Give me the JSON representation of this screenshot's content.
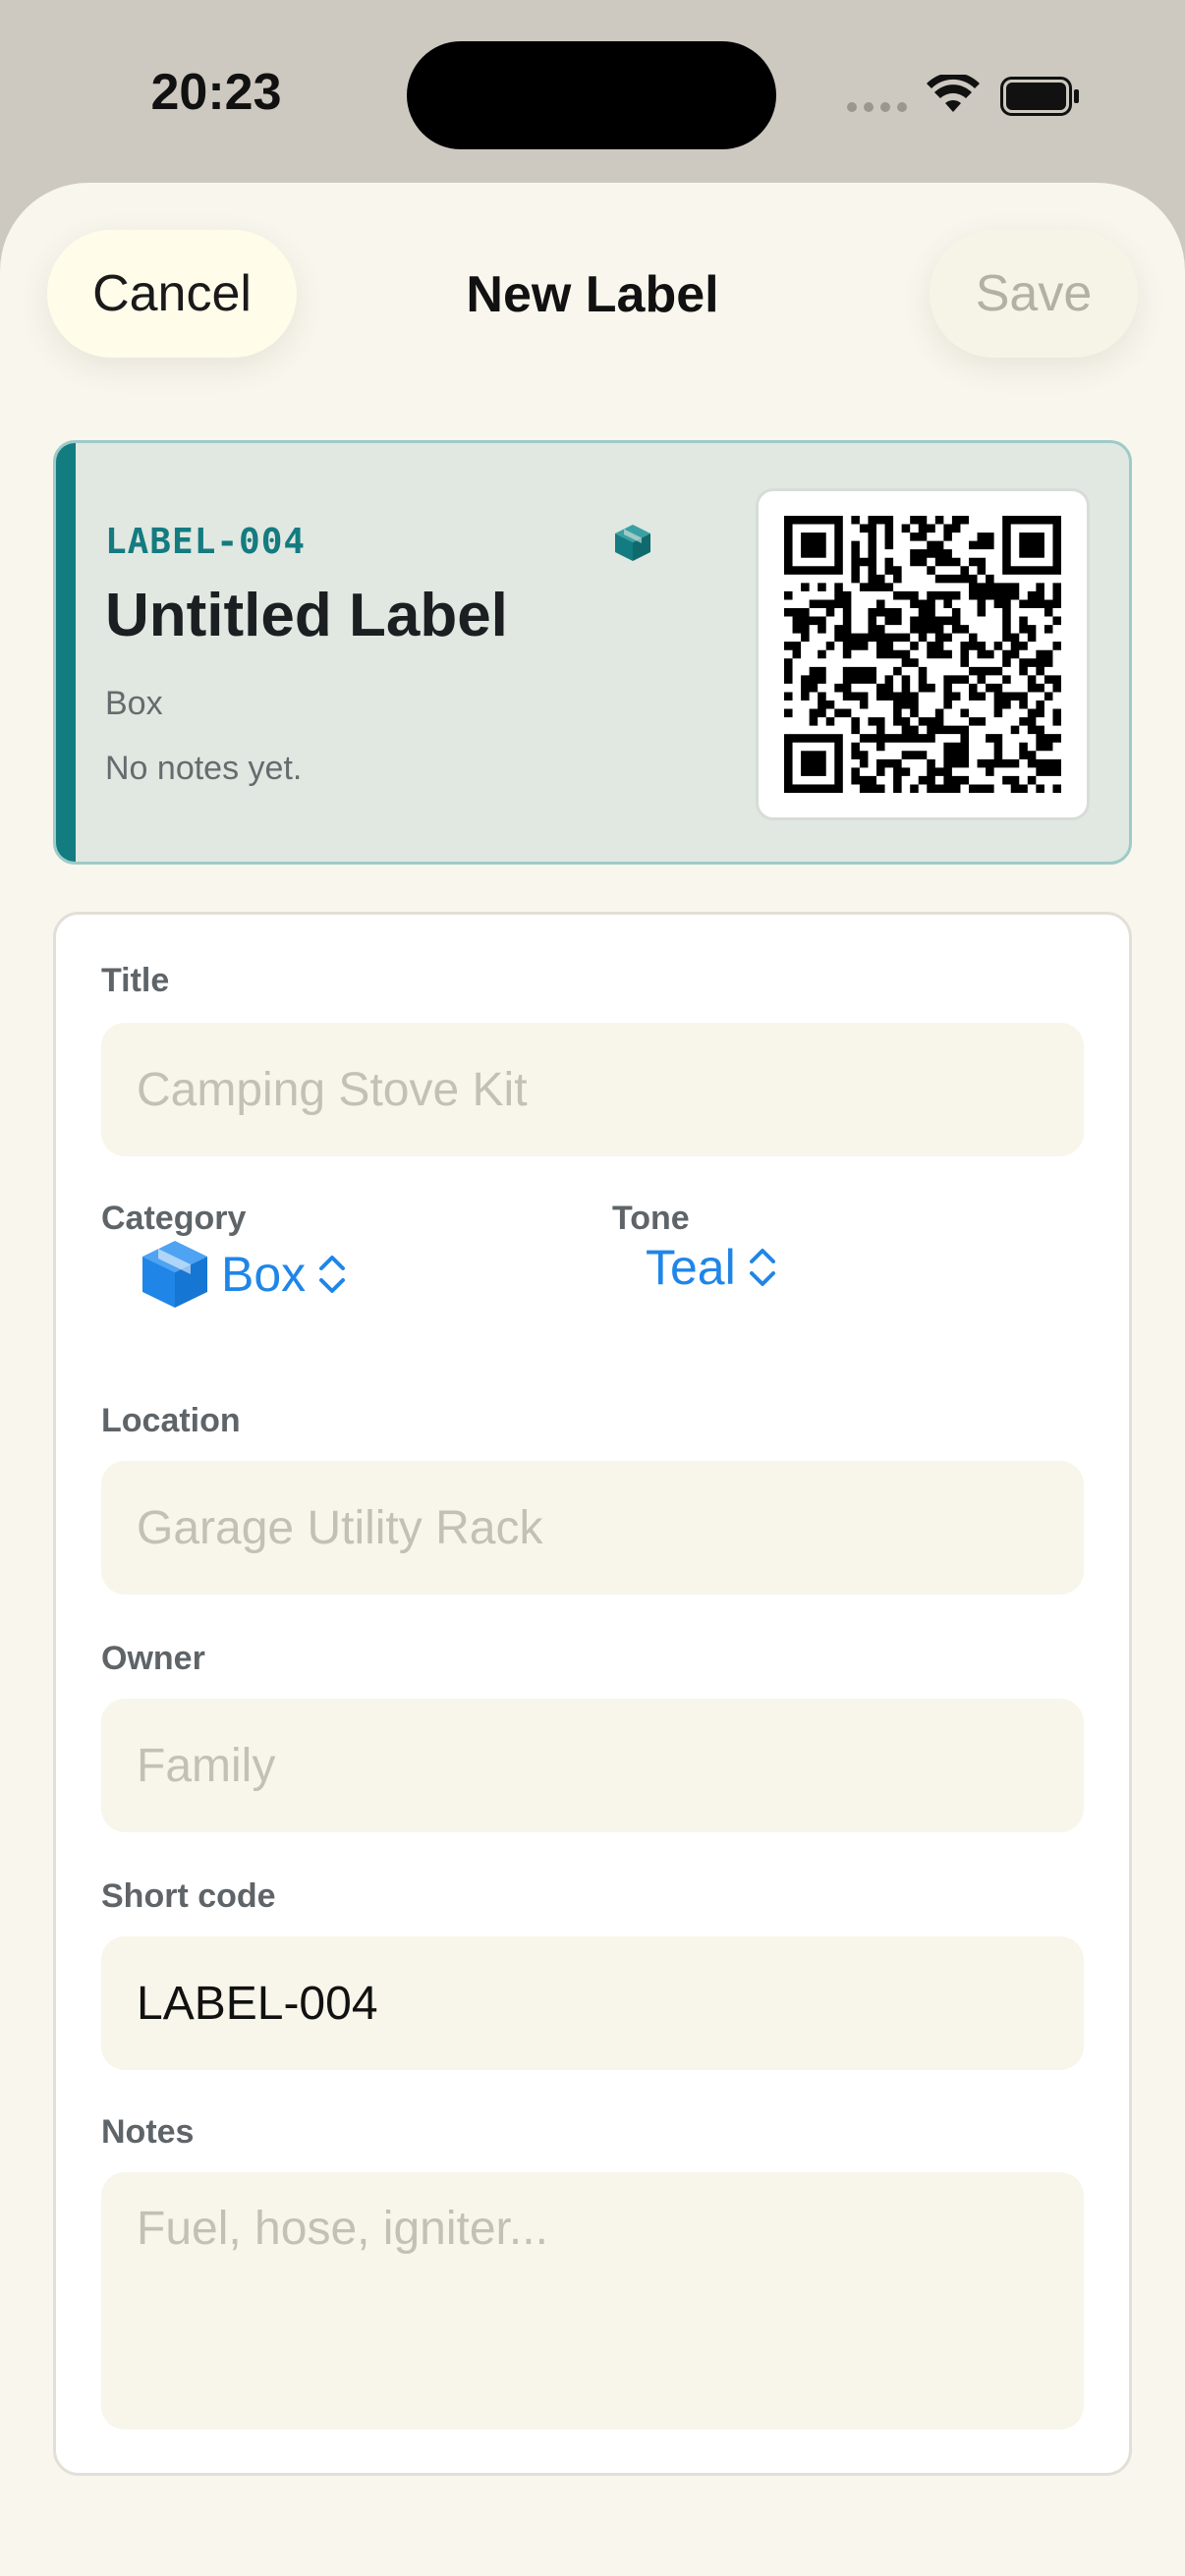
{
  "status_bar": {
    "time": "20:23"
  },
  "nav": {
    "cancel_label": "Cancel",
    "title": "New Label",
    "save_label": "Save"
  },
  "preview": {
    "code": "LABEL-004",
    "title": "Untitled Label",
    "category": "Box",
    "notes": "No notes yet.",
    "accent_color": "#127c80"
  },
  "form": {
    "title": {
      "label": "Title",
      "placeholder": "Camping Stove Kit",
      "value": ""
    },
    "category": {
      "label": "Category",
      "value": "Box",
      "icon": "cube-icon"
    },
    "tone": {
      "label": "Tone",
      "value": "Teal"
    },
    "location": {
      "label": "Location",
      "placeholder": "Garage Utility Rack",
      "value": ""
    },
    "owner": {
      "label": "Owner",
      "placeholder": "Family",
      "value": ""
    },
    "short_code": {
      "label": "Short code",
      "value": "LABEL-004"
    },
    "notes": {
      "label": "Notes",
      "placeholder": "Fuel, hose, igniter...",
      "value": ""
    }
  },
  "colors": {
    "accent_blue": "#1f86e8",
    "teal": "#127c80",
    "sheet_bg": "#f8f6ed"
  }
}
